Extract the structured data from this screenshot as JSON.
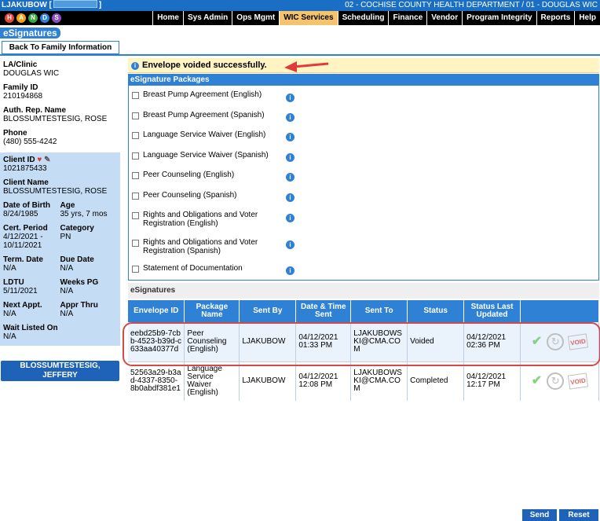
{
  "topbar": {
    "user": "LJAKUBOW [",
    "user_end": "]",
    "department": "02 - COCHISE COUNTY HEALTH DEPARTMENT / 01 - DOUGLAS WIC"
  },
  "nav": {
    "items": [
      "Home",
      "Sys Admin",
      "Ops Mgmt",
      "WIC Services",
      "Scheduling",
      "Finance",
      "Vendor",
      "Program Integrity",
      "Reports",
      "Help"
    ],
    "active": "WIC Services"
  },
  "logo": {
    "letters": [
      "H",
      "A",
      "N",
      "D",
      "S"
    ]
  },
  "page": {
    "section_label": "eSignatures",
    "back_button": "Back To Family Information"
  },
  "left": {
    "la_clinic_label": "LA/Clinic",
    "la_clinic_value": "DOUGLAS WIC",
    "family_id_label": "Family ID",
    "family_id_value": "210194868",
    "auth_rep_label": "Auth. Rep. Name",
    "auth_rep_value": "BLOSSUMTESTESIG, ROSE",
    "phone_label": "Phone",
    "phone_value": "(480) 555-4242",
    "client_id_label": "Client ID",
    "client_id_value": "1021875433",
    "client_name_label": "Client Name",
    "client_name_value": "BLOSSUMTESTESIG, ROSE",
    "dob_label": "Date of Birth",
    "dob_value": "8/24/1985",
    "age_label": "Age",
    "age_value": "35 yrs, 7 mos",
    "cert_label": "Cert. Period",
    "cert_value_1": "4/12/2021 -",
    "cert_value_2": "10/11/2021",
    "category_label": "Category",
    "category_value": "PN",
    "term_label": "Term. Date",
    "term_value": "N/A",
    "due_label": "Due Date",
    "due_value": "N/A",
    "ldtu_label": "LDTU",
    "ldtu_value": "5/11/2021",
    "weeks_label": "Weeks PG",
    "weeks_value": "N/A",
    "next_label": "Next Appt.",
    "next_value": "N/A",
    "appr_label": "Appr Thru",
    "appr_value": "N/A",
    "wait_label": "Wait Listed On",
    "wait_value": "N/A",
    "client_button_1": "BLOSSUMTESTESIG,",
    "client_button_2": "JEFFERY"
  },
  "message": {
    "success": "Envelope voided successfully."
  },
  "packages": {
    "header": "eSignature Packages",
    "items": [
      "Breast Pump Agreement (English)",
      "Breast Pump Agreement (Spanish)",
      "Language Service Waiver (English)",
      "Language Service Waiver (Spanish)",
      "Peer Counseling (English)",
      "Peer Counseling (Spanish)",
      "Rights and Obligations and Voter Registration (English)",
      "Rights and Obligations and Voter Registration (Spanish)",
      "Statement of Documentation"
    ]
  },
  "esignatures": {
    "title": "eSignatures",
    "columns": [
      "Envelope ID",
      "Package Name",
      "Sent By",
      "Date & Time Sent",
      "Sent To",
      "Status",
      "Status Last Updated"
    ],
    "rows": [
      {
        "envelope_id": "eebd25b9-7cbb-4523-b39d-c633aa40377d",
        "package": "Peer Counseling (English)",
        "sent_by": "LJAKUBOW",
        "date_sent": "04/12/2021 01:33 PM",
        "sent_to": "LJAKUBOWSKI@CMA.COM",
        "status": "Voided",
        "updated": "04/12/2021 02:36 PM"
      },
      {
        "envelope_id": "52563a29-b3ad-4337-8350-8b0abdf381e1",
        "package": "Language Service Waiver (English)",
        "sent_by": "LJAKUBOW",
        "date_sent": "04/12/2021 12:08 PM",
        "sent_to": "LJAKUBOWSKI@CMA.COM",
        "status": "Completed",
        "updated": "04/12/2021 12:17 PM"
      }
    ],
    "void_label": "VOID"
  },
  "buttons": {
    "send": "Send",
    "reset": "Reset"
  },
  "colors": {
    "primary": "#2f81d6",
    "nav_active": "#f4c36b",
    "success_bg": "#fff4c2",
    "highlight": "#d34a4a"
  }
}
